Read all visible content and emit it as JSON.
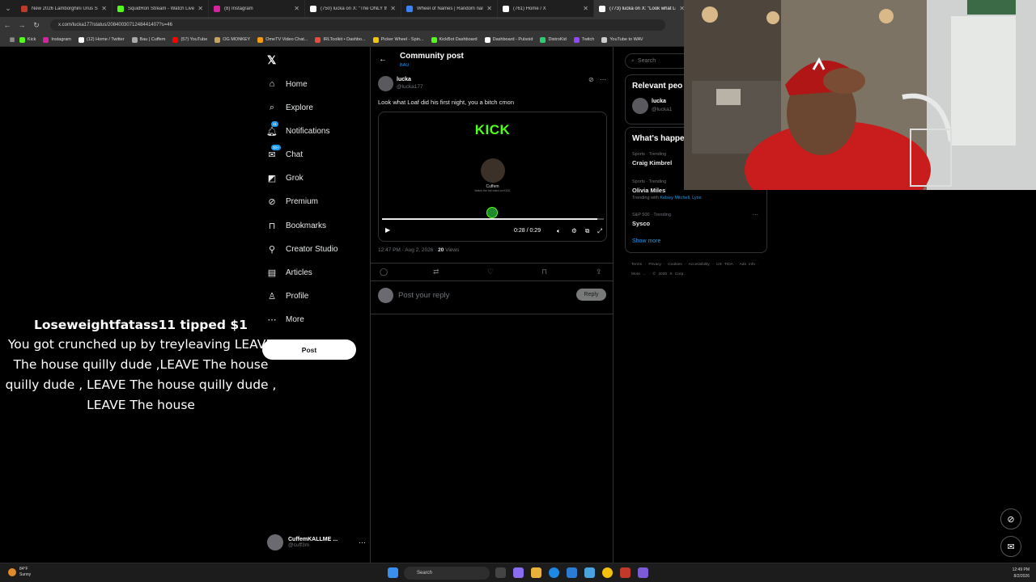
{
  "browser": {
    "tabs": [
      {
        "title": "New 2026 Lamborghini Urus S",
        "color": "#c0392b",
        "active": false
      },
      {
        "title": "SquidRon Stream - Watch Live",
        "color": "#53fc18",
        "active": false
      },
      {
        "title": "(8) Instagram",
        "color": "#d6249f",
        "active": false
      },
      {
        "title": "(750) lucka on X: \"The ONLY th",
        "color": "#ffffff",
        "active": false
      },
      {
        "title": "Wheel of Names | Random nam",
        "color": "#3b82f6",
        "active": false
      },
      {
        "title": "(761) Home / X",
        "color": "#ffffff",
        "active": false
      },
      {
        "title": "(773) lucka on X: \"Look what Lo",
        "color": "#ffffff",
        "active": true
      }
    ],
    "url": "x.com/lucka177/status/2084003071248441407?s=46",
    "bookmarks": [
      {
        "label": "Kick",
        "color": "#53fc18"
      },
      {
        "label": "Instagram",
        "color": "#d6249f"
      },
      {
        "label": "(12) Home / Twitter",
        "color": "#ffffff"
      },
      {
        "label": "Bau | Cuffem",
        "color": "#aaaaaa"
      },
      {
        "label": "(57) YouTube",
        "color": "#ff0000"
      },
      {
        "label": "OG MONKEY",
        "color": "#c8a45a"
      },
      {
        "label": "OmeTV Video Chat...",
        "color": "#f39c12"
      },
      {
        "label": "IRLToolkit • Dashbo...",
        "color": "#e74c3c"
      },
      {
        "label": "Picker Wheel - Spin...",
        "color": "#f1c40f"
      },
      {
        "label": "KickBot Dashboard",
        "color": "#53fc18"
      },
      {
        "label": "Dashboard - Pulsoid",
        "color": "#ffffff"
      },
      {
        "label": "DistroKid",
        "color": "#2ecc71"
      },
      {
        "label": "Twitch",
        "color": "#9146ff"
      },
      {
        "label": "YouTube to WAV",
        "color": "#cccccc"
      }
    ]
  },
  "sidebar": {
    "items": [
      {
        "label": "Home",
        "icon": "home-icon",
        "glyph": "⌂"
      },
      {
        "label": "Explore",
        "icon": "search-icon",
        "glyph": "⌕"
      },
      {
        "label": "Notifications",
        "icon": "bell-icon",
        "glyph": "🔔︎",
        "badge": "11"
      },
      {
        "label": "Chat",
        "icon": "chat-icon",
        "glyph": "✉",
        "badge": "20+"
      },
      {
        "label": "Grok",
        "icon": "grok-icon",
        "glyph": "◩"
      },
      {
        "label": "Premium",
        "icon": "premium-icon",
        "glyph": "⊘"
      },
      {
        "label": "Bookmarks",
        "icon": "bookmark-icon",
        "glyph": "⊓"
      },
      {
        "label": "Creator Studio",
        "icon": "creator-studio-icon",
        "glyph": "⚲"
      },
      {
        "label": "Articles",
        "icon": "articles-icon",
        "glyph": "▤"
      },
      {
        "label": "Profile",
        "icon": "profile-icon",
        "glyph": "♙"
      },
      {
        "label": "More",
        "icon": "more-icon",
        "glyph": "⋯"
      }
    ],
    "post_label": "Post",
    "account": {
      "name": "CuffemKALLME ...",
      "handle": "@cuff3m"
    }
  },
  "post": {
    "header_title": "Community post",
    "header_sub": "BAU",
    "author_name": "lucka",
    "author_handle": "@lucka177",
    "text": "Look what Loaf did his first night, you a bitch cmon",
    "video": {
      "brand": "KICK",
      "streamer": "Cuffem",
      "streamer_sub": "Watch the full video on KICK",
      "time": "0:28 / 0:29",
      "progress": 0.97
    },
    "timestamp": "12:47 PM · Aug 2, 2026 · ",
    "views_count": "20",
    "views_label": " Views",
    "reply_placeholder": "Post your reply",
    "reply_button": "Reply"
  },
  "right": {
    "search_placeholder": "Search",
    "relevant_title": "Relevant peo",
    "relevant_person": {
      "name": "lucka",
      "handle": "@lucka1"
    },
    "happening_title": "What's happe",
    "trends": [
      {
        "category": "Sports · Trending",
        "name": "Craig Kimbrel",
        "with_prefix": "",
        "with": ""
      },
      {
        "category": "Sports · Trending",
        "name": "Olivia Miles",
        "with_prefix": "Trending with ",
        "with": "Kelsey Mitchell, Lynx"
      },
      {
        "category": "S&P 500 · Trending",
        "name": "Sysco",
        "with_prefix": "",
        "with": ""
      }
    ],
    "show_more": "Show more",
    "footer": "Terms · Privacy · Cookies · Accessibility · US TIDA · Ads info · More ... · © 2026 X Corp."
  },
  "overlay": {
    "tip_title": "Loseweightfatass11 tipped $1",
    "tip_message": "You got crunched up by treyleaving LEAVE The house quilly dude ,LEAVE The house quilly dude , LEAVE The house quilly dude , LEAVE The house"
  },
  "taskbar": {
    "weather_temp": "84°F",
    "weather_desc": "Sunny",
    "search_label": "Search",
    "time": "12:49 PM",
    "date": "8/2/2026"
  }
}
